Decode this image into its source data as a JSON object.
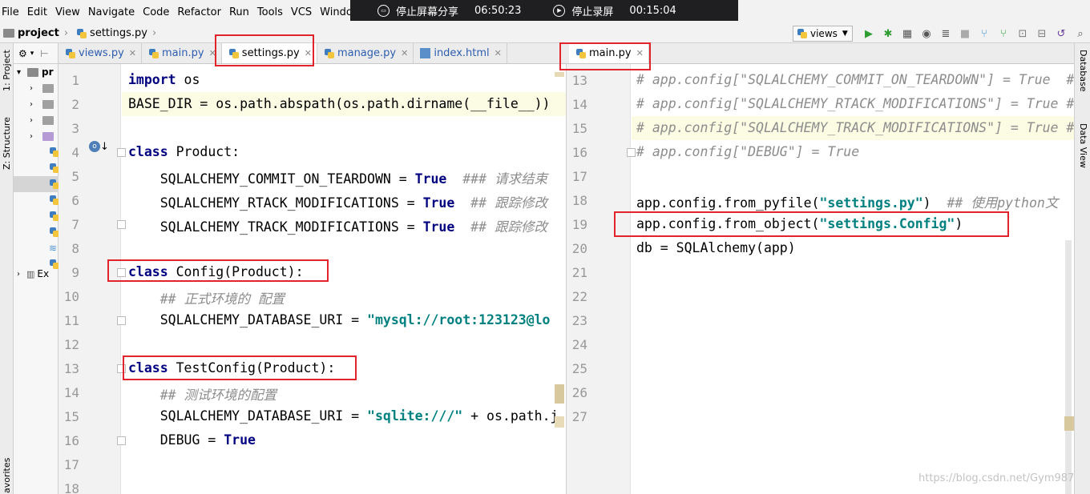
{
  "menu": [
    {
      "label": "File"
    },
    {
      "label": "Edit"
    },
    {
      "label": "View"
    },
    {
      "label": "Navigate"
    },
    {
      "label": "Code"
    },
    {
      "label": "Refactor"
    },
    {
      "label": "Run"
    },
    {
      "label": "Tools"
    },
    {
      "label": "VCS"
    },
    {
      "label": "Window"
    }
  ],
  "overlay": {
    "stop_share": "停止屏幕分享",
    "share_time": "06:50:23",
    "stop_record": "停止录屏",
    "record_time": "00:15:04"
  },
  "breadcrumb": {
    "project": "project",
    "file": "settings.py"
  },
  "run_config": {
    "label": "views"
  },
  "side_tools": {
    "project": "1: Project",
    "structure": "Z: Structure",
    "favorites": "avorites",
    "database": "Database",
    "dataview": "Data View"
  },
  "tree": {
    "root": "pr",
    "external": "Ex"
  },
  "tabs_left": [
    {
      "label": "views.py",
      "active": false
    },
    {
      "label": "main.py",
      "active": false
    },
    {
      "label": "settings.py",
      "active": true
    },
    {
      "label": "manage.py",
      "active": false
    },
    {
      "label": "index.html",
      "active": false
    }
  ],
  "tabs_right": [
    {
      "label": "main.py",
      "active": true
    }
  ],
  "editor_left": {
    "line_numbers": [
      "1",
      "2",
      "3",
      "4",
      "5",
      "6",
      "7",
      "8",
      "9",
      "10",
      "11",
      "12",
      "13",
      "14",
      "15",
      "16",
      "17",
      "18"
    ],
    "lines": {
      "l1_kw": "import",
      "l1_rest": " os",
      "l2": "BASE_DIR = os.path.abspath(os.path.dirname(__file__))",
      "l4_kw": "class",
      "l4_rest": " Product:",
      "l5_a": "    SQLALCHEMY_COMMIT_ON_TEARDOWN = ",
      "l5_kw": "True",
      "l5_c": "  ### 请求结束",
      "l6_a": "    SQLALCHEMY_RTACK_MODIFICATIONS = ",
      "l6_kw": "True",
      "l6_c": "  ## 跟踪修改",
      "l7_a": "    SQLALCHEMY_TRACK_MODIFICATIONS = ",
      "l7_kw": "True",
      "l7_c": "  ## 跟踪修改",
      "l9_kw": "class",
      "l9_rest": " Config(Product):",
      "l10_c": "    ## 正式环境的 配置",
      "l11_a": "    SQLALCHEMY_DATABASE_URI = ",
      "l11_s": "\"mysql://root:123123@lo",
      "l13_kw": "class",
      "l13_rest": " TestConfig(Product):",
      "l14_c": "    ## 测试环境的配置",
      "l15_a": "    SQLALCHEMY_DATABASE_URI = ",
      "l15_s": "\"sqlite:///\"",
      "l15_b": " + os.path.j",
      "l16_a": "    DEBUG = ",
      "l16_kw": "True"
    }
  },
  "editor_right": {
    "line_numbers": [
      "13",
      "14",
      "15",
      "16",
      "17",
      "18",
      "19",
      "20",
      "21",
      "22",
      "23",
      "24",
      "25",
      "26",
      "27"
    ],
    "lines": {
      "r13": "# app.config[\"SQLALCHEMY_COMMIT_ON_TEARDOWN\"] = True  #",
      "r14": "# app.config[\"SQLALCHEMY_RTACK_MODIFICATIONS\"] = True #",
      "r15": "# app.config[\"SQLALCHEMY_TRACK_MODIFICATIONS\"] = True #",
      "r16": "# app.config[\"DEBUG\"] = True",
      "r18_a": "app.config.from_pyfile(",
      "r18_s": "\"settings.py\"",
      "r18_b": ")  ",
      "r18_c": "## 使用python文",
      "r19_a": "app.config.from_object(",
      "r19_s": "\"settings.Config\"",
      "r19_b": ")",
      "r20": "db = SQLAlchemy(app)"
    }
  },
  "watermark": "https://blog.csdn.net/Gym987",
  "colors": {
    "highlight_box": "#e0242a",
    "keyword": "#000080",
    "string": "#008080",
    "comment": "#8c8c8c"
  }
}
